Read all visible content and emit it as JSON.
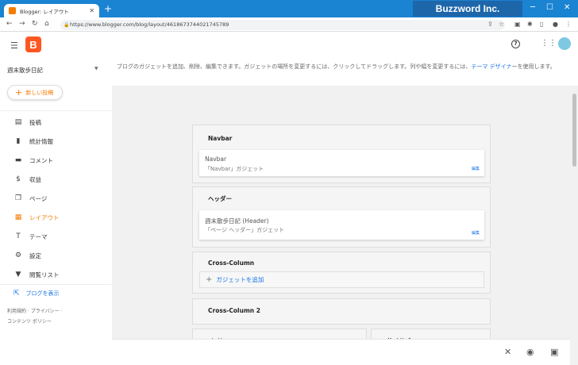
{
  "browser": {
    "tab_title": "Blogger: レイアウト",
    "tab_close": "✕",
    "new_tab": "+",
    "url": "https://www.blogger.com/blog/layout/4618673744021745789",
    "brand": "Buzzword Inc."
  },
  "app": {
    "blog_name": "週末散歩日記",
    "new_post_label": "新しい投稿",
    "logo_letter": "B"
  },
  "sidebar": {
    "items": [
      {
        "label": "投稿",
        "icon": "posts-icon",
        "active": false
      },
      {
        "label": "統計情報",
        "icon": "stats-icon",
        "active": false
      },
      {
        "label": "コメント",
        "icon": "comment-icon",
        "active": false
      },
      {
        "label": "収益",
        "icon": "dollar-icon",
        "active": false
      },
      {
        "label": "ページ",
        "icon": "pages-icon",
        "active": false
      },
      {
        "label": "レイアウト",
        "icon": "layout-icon",
        "active": true
      },
      {
        "label": "テーマ",
        "icon": "theme-icon",
        "active": false
      },
      {
        "label": "設定",
        "icon": "gear-icon",
        "active": false
      },
      {
        "label": "閲覧リスト",
        "icon": "bookmark-icon",
        "active": false
      }
    ],
    "view_blog_label": "ブログを表示",
    "footer_line1": "利用規約 · プライバシー ·",
    "footer_line2": "コンテンツ ポリシー"
  },
  "main": {
    "info_text": "ブログのガジェットを追加、削除、編集できます。ガジェットの場所を変更するには、クリックしてドラッグします。列や幅を変更するには、",
    "info_link": "テーマ デザイナ",
    "info_text2": "ーを使用します。"
  },
  "sections": {
    "navbar": {
      "title": "Navbar",
      "gadget_name": "Navbar",
      "gadget_type": "「Navbar」ガジェット",
      "edit": "編集"
    },
    "header": {
      "title": "ヘッダー",
      "gadget_name": "週末散歩日記 (Header)",
      "gadget_type": "「ページ ヘッダー」ガジェット",
      "edit": "編集"
    },
    "cross_column": {
      "title": "Cross-Column",
      "add_gadget": "ガジェットを追加"
    },
    "cross_column_2": {
      "title": "Cross-Column 2"
    },
    "main_col": {
      "title": "メイン"
    },
    "sidebar_col": {
      "title": "サイドバー"
    }
  },
  "colors": {
    "accent": "#f57c00",
    "link": "#1a73e8",
    "titlebar": "#1a83d2"
  }
}
